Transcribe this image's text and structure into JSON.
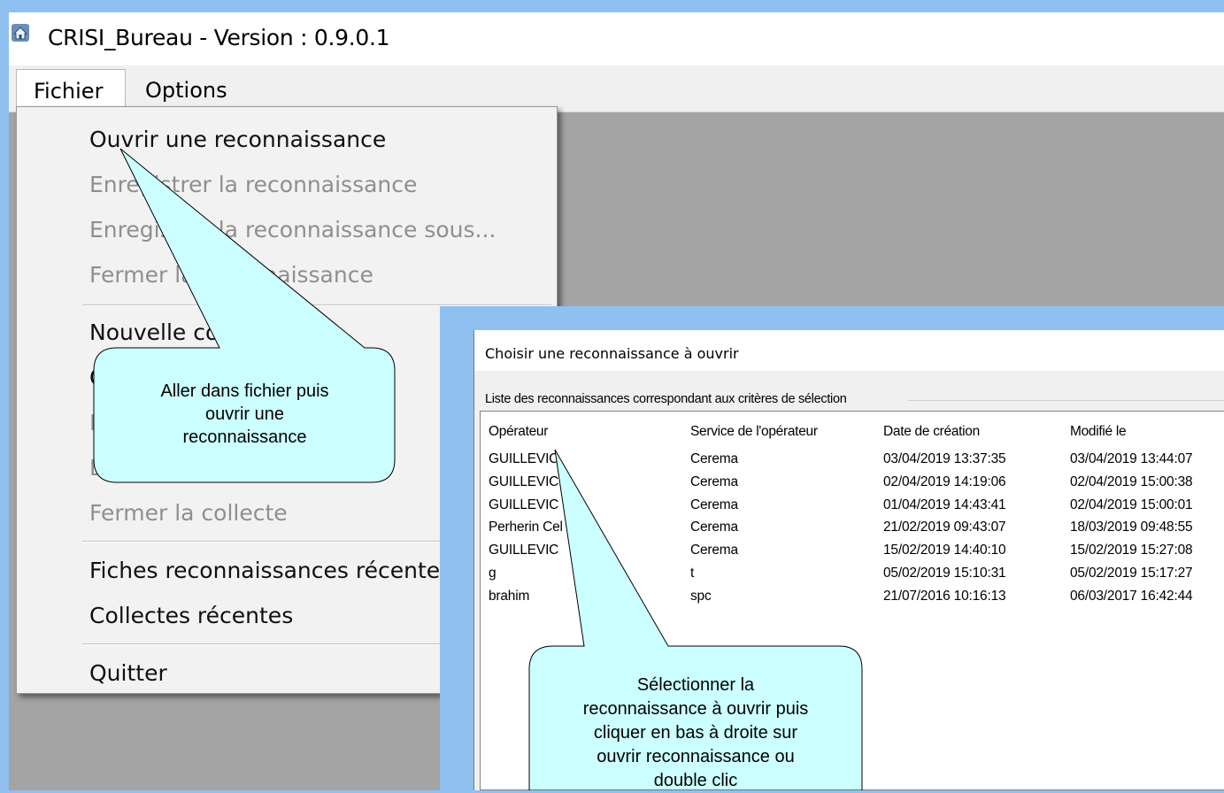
{
  "window": {
    "title": "CRISI_Bureau - Version : 0.9.0.1",
    "icon": "app-house-icon"
  },
  "menubar": {
    "fichier": "Fichier",
    "options": "Options"
  },
  "file_menu": {
    "items": [
      {
        "label": "Ouvrir une reconnaissance",
        "enabled": true
      },
      {
        "label": "Enregistrer la reconnaissance",
        "enabled": false
      },
      {
        "label": "Enregistrer la reconnaissance sous...",
        "enabled": false
      },
      {
        "label": "Fermer la reconnaissance",
        "enabled": false
      },
      {
        "label": "Nouvelle collecte",
        "enabled": true
      },
      {
        "label": "O",
        "enabled": true
      },
      {
        "label": "E",
        "enabled": false
      },
      {
        "label": "E",
        "enabled": false
      },
      {
        "label": "Fermer la collecte",
        "enabled": false
      },
      {
        "label": "Fiches reconnaissances récentes",
        "enabled": true
      },
      {
        "label": "Collectes récentes",
        "enabled": true
      },
      {
        "label": "Quitter",
        "enabled": true
      }
    ]
  },
  "dialog": {
    "title": "Choisir une reconnaissance à ouvrir",
    "group_label": "Liste des reconnaissances correspondant aux critères de sélection",
    "columns": [
      "Opérateur",
      "Service de l'opérateur",
      "Date de création",
      "Modifié le"
    ],
    "rows": [
      [
        "GUILLEVIC",
        "Cerema",
        "03/04/2019 13:37:35",
        "03/04/2019 13:44:07"
      ],
      [
        "GUILLEVIC",
        "Cerema",
        "02/04/2019 14:19:06",
        "02/04/2019 15:00:38"
      ],
      [
        "GUILLEVIC",
        "Cerema",
        "01/04/2019 14:43:41",
        "02/04/2019 15:00:01"
      ],
      [
        "Perherin Cel",
        "Cerema",
        "21/02/2019 09:43:07",
        "18/03/2019 09:48:55"
      ],
      [
        "GUILLEVIC",
        "Cerema",
        "15/02/2019 14:40:10",
        "15/02/2019 15:27:08"
      ],
      [
        "g",
        "t",
        "05/02/2019 15:10:31",
        "05/02/2019 15:17:27"
      ],
      [
        "brahim",
        "spc",
        "21/07/2016 10:16:13",
        "06/03/2017 16:42:44"
      ]
    ]
  },
  "callouts": {
    "first": [
      "Aller dans fichier puis",
      "ouvrir une",
      "reconnaissance"
    ],
    "second": [
      "Sélectionner la",
      "reconnaissance à ouvrir puis",
      "cliquer en bas à droite sur",
      "ouvrir reconnaissance ou",
      "double clic"
    ]
  },
  "colors": {
    "frame_blue": "#8fc0ef",
    "workspace_gray": "#a4a4a4",
    "callout_fill": "#ccffff"
  }
}
